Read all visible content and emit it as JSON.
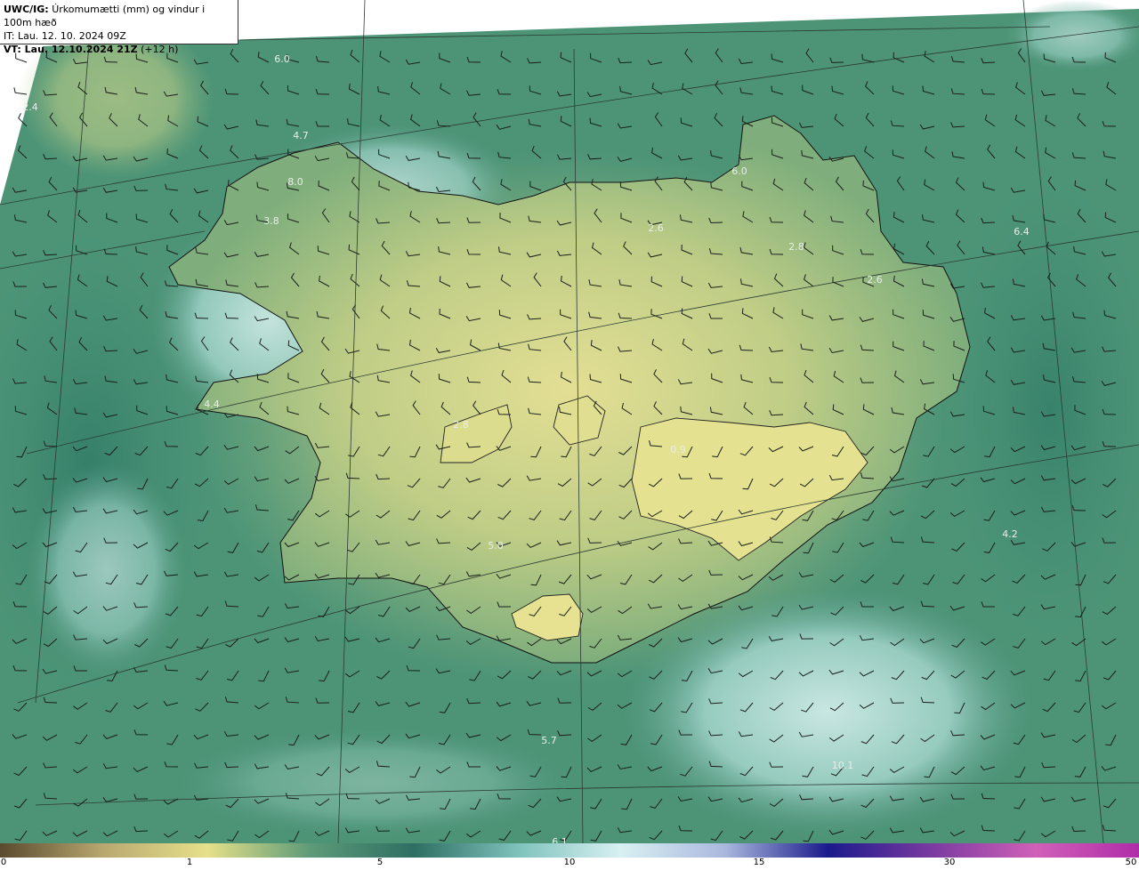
{
  "header": {
    "model": "UWC/IG:",
    "description": "Úrkomumætti (mm) og vindur i 100m hæð",
    "init_time": "IT: Lau. 12. 10. 2024 09Z",
    "valid_time_prefix": "VT: Lau. 12.10.2024 21Z",
    "valid_time_suffix": " (+12 h)"
  },
  "colorbar": {
    "ticks": [
      "0",
      "1",
      "5",
      "10",
      "15",
      "30",
      "50"
    ],
    "colors": [
      "#5a4a2e",
      "#b9a870",
      "#e6e08a",
      "#5c9a78",
      "#2e6f63",
      "#7fc2bc",
      "#d8f0f2",
      "#aab8de",
      "#1b1a8c",
      "#7a3aa0",
      "#d060b8",
      "#b02da8"
    ]
  },
  "map_labels": [
    "6.0",
    "2.4",
    "4.7",
    "8.0",
    "3.8",
    "4.4",
    "2.8",
    "2.6",
    "2.8",
    "2.6",
    "6.0",
    "6.4",
    "0.9",
    "5.0",
    "4.2",
    "5.7",
    "10.1",
    "6.1"
  ]
}
